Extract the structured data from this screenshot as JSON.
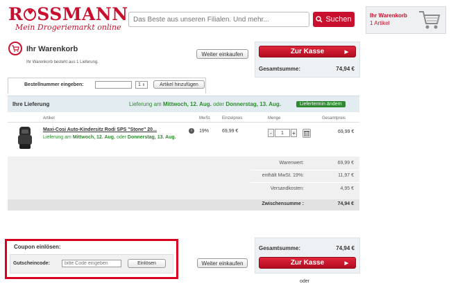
{
  "header": {
    "logo": "ROSSMANN",
    "logo_pre": "R",
    "logo_post": "SSMANN",
    "tagline": "Mein Drogeriemarkt online",
    "search_placeholder": "Das Beste aus unseren Filialen. Und mehr...",
    "search_button": "Suchen",
    "cart_label": "Ihr Warenkorb",
    "cart_count": "1 Artikel"
  },
  "cart": {
    "title": "Ihr Warenkorb",
    "subtitle": "Ihr Warenkorb besteht aus 1 Lieferung.",
    "continue_label": "Weiter einkaufen",
    "checkout_label": "Zur Kasse",
    "total_label": "Gesamtsumme:",
    "total_value": "74,94 €"
  },
  "ordernum": {
    "label": "Bestellnummer eingeben:",
    "qty": "1",
    "add_button": "Artikel hinzufügen"
  },
  "delivery": {
    "title": "Ihre Lieferung",
    "delivery_pre": "Lieferung am ",
    "delivery_bold1": "Mittwoch, 12. Aug.",
    "delivery_mid": " oder ",
    "delivery_bold2": "Donnerstag, 13. Aug.",
    "change_button": "Liefertermin ändern",
    "columns": [
      "Artikel",
      "MwSt.",
      "Einzelpreis",
      "Menge",
      "Gesamtpreis"
    ]
  },
  "item": {
    "name": "Maxi-Cosi Auto-Kindersitz Rodi SPS \"Stone\" 20...",
    "delivery_pre": "Lieferung am ",
    "delivery_bold1": "Mittwoch, 12. Aug.",
    "delivery_mid": " oder ",
    "delivery_bold2": "Donnerstag, 13. Aug.",
    "vat": "19%",
    "unit_price": "69,99 €",
    "qty": "1",
    "total": "69,99 €"
  },
  "summary": {
    "rows": [
      {
        "label": "Warenwert:",
        "value": "69,99 €"
      },
      {
        "label": "enthält MwSt. 19%:",
        "value": "11,97 €"
      },
      {
        "label": "Versandkosten:",
        "value": "4,95 €"
      }
    ],
    "subtotal_label": "Zwischensumme :",
    "subtotal_value": "74,94 €"
  },
  "coupon": {
    "title": "Coupon einlösen:",
    "code_label": "Gutscheincode:",
    "code_placeholder": "bitte Code eingeben",
    "redeem_button": "Einlösen"
  },
  "footer": {
    "continue_label": "Weiter einkaufen",
    "total_label": "Gesamtsumme:",
    "total_value": "74,94 €",
    "checkout_label": "Zur Kasse",
    "or_label": "oder"
  },
  "colors": {
    "brand_red": "#c8102e",
    "green": "#2e8a2e",
    "highlight_outline": "#d7001e"
  },
  "icons": [
    "heart-logo-icon",
    "search-icon",
    "shopping-cart-icon",
    "info-icon",
    "trash-icon",
    "arrow-right-icon"
  ]
}
